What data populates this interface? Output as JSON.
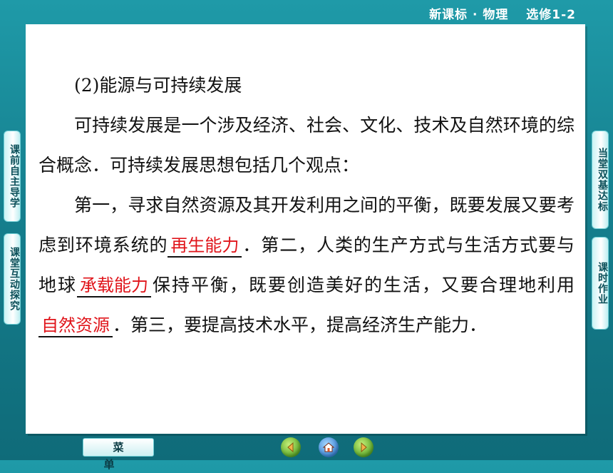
{
  "header": {
    "title": "新课标 · 物理　 选修1-2"
  },
  "left_tabs": [
    {
      "label": "课前自主导学"
    },
    {
      "label": "课堂互动探究"
    }
  ],
  "right_tabs": [
    {
      "label": "当堂双基达标"
    },
    {
      "label": "课时作业"
    }
  ],
  "content": {
    "heading": "(2)能源与可持续发展",
    "para1": "可持续发展是一个涉及经济、社会、文化、技术及自然环境的综合概念．可持续发展思想包括几个观点：",
    "para2": {
      "part1": "第一，寻求自然资源及其开发利用之间的平衡，既要发展又要考虑到环境系统的",
      "blank1": "再生能力",
      "part2": "．第二，人类的生产方式与生活方式要与地球",
      "blank2": "承载能力",
      "part3": "保持平衡，既要创造美好的生活，又要合理地利用",
      "blank3": "自然资源",
      "part4": "．第三，要提高技术水平，提高经济生产能力．"
    },
    "blank_color": "#e0141a"
  },
  "bottom": {
    "menu_label": "菜单",
    "nav_icons": [
      "back-icon",
      "home-icon",
      "forward-icon"
    ]
  }
}
